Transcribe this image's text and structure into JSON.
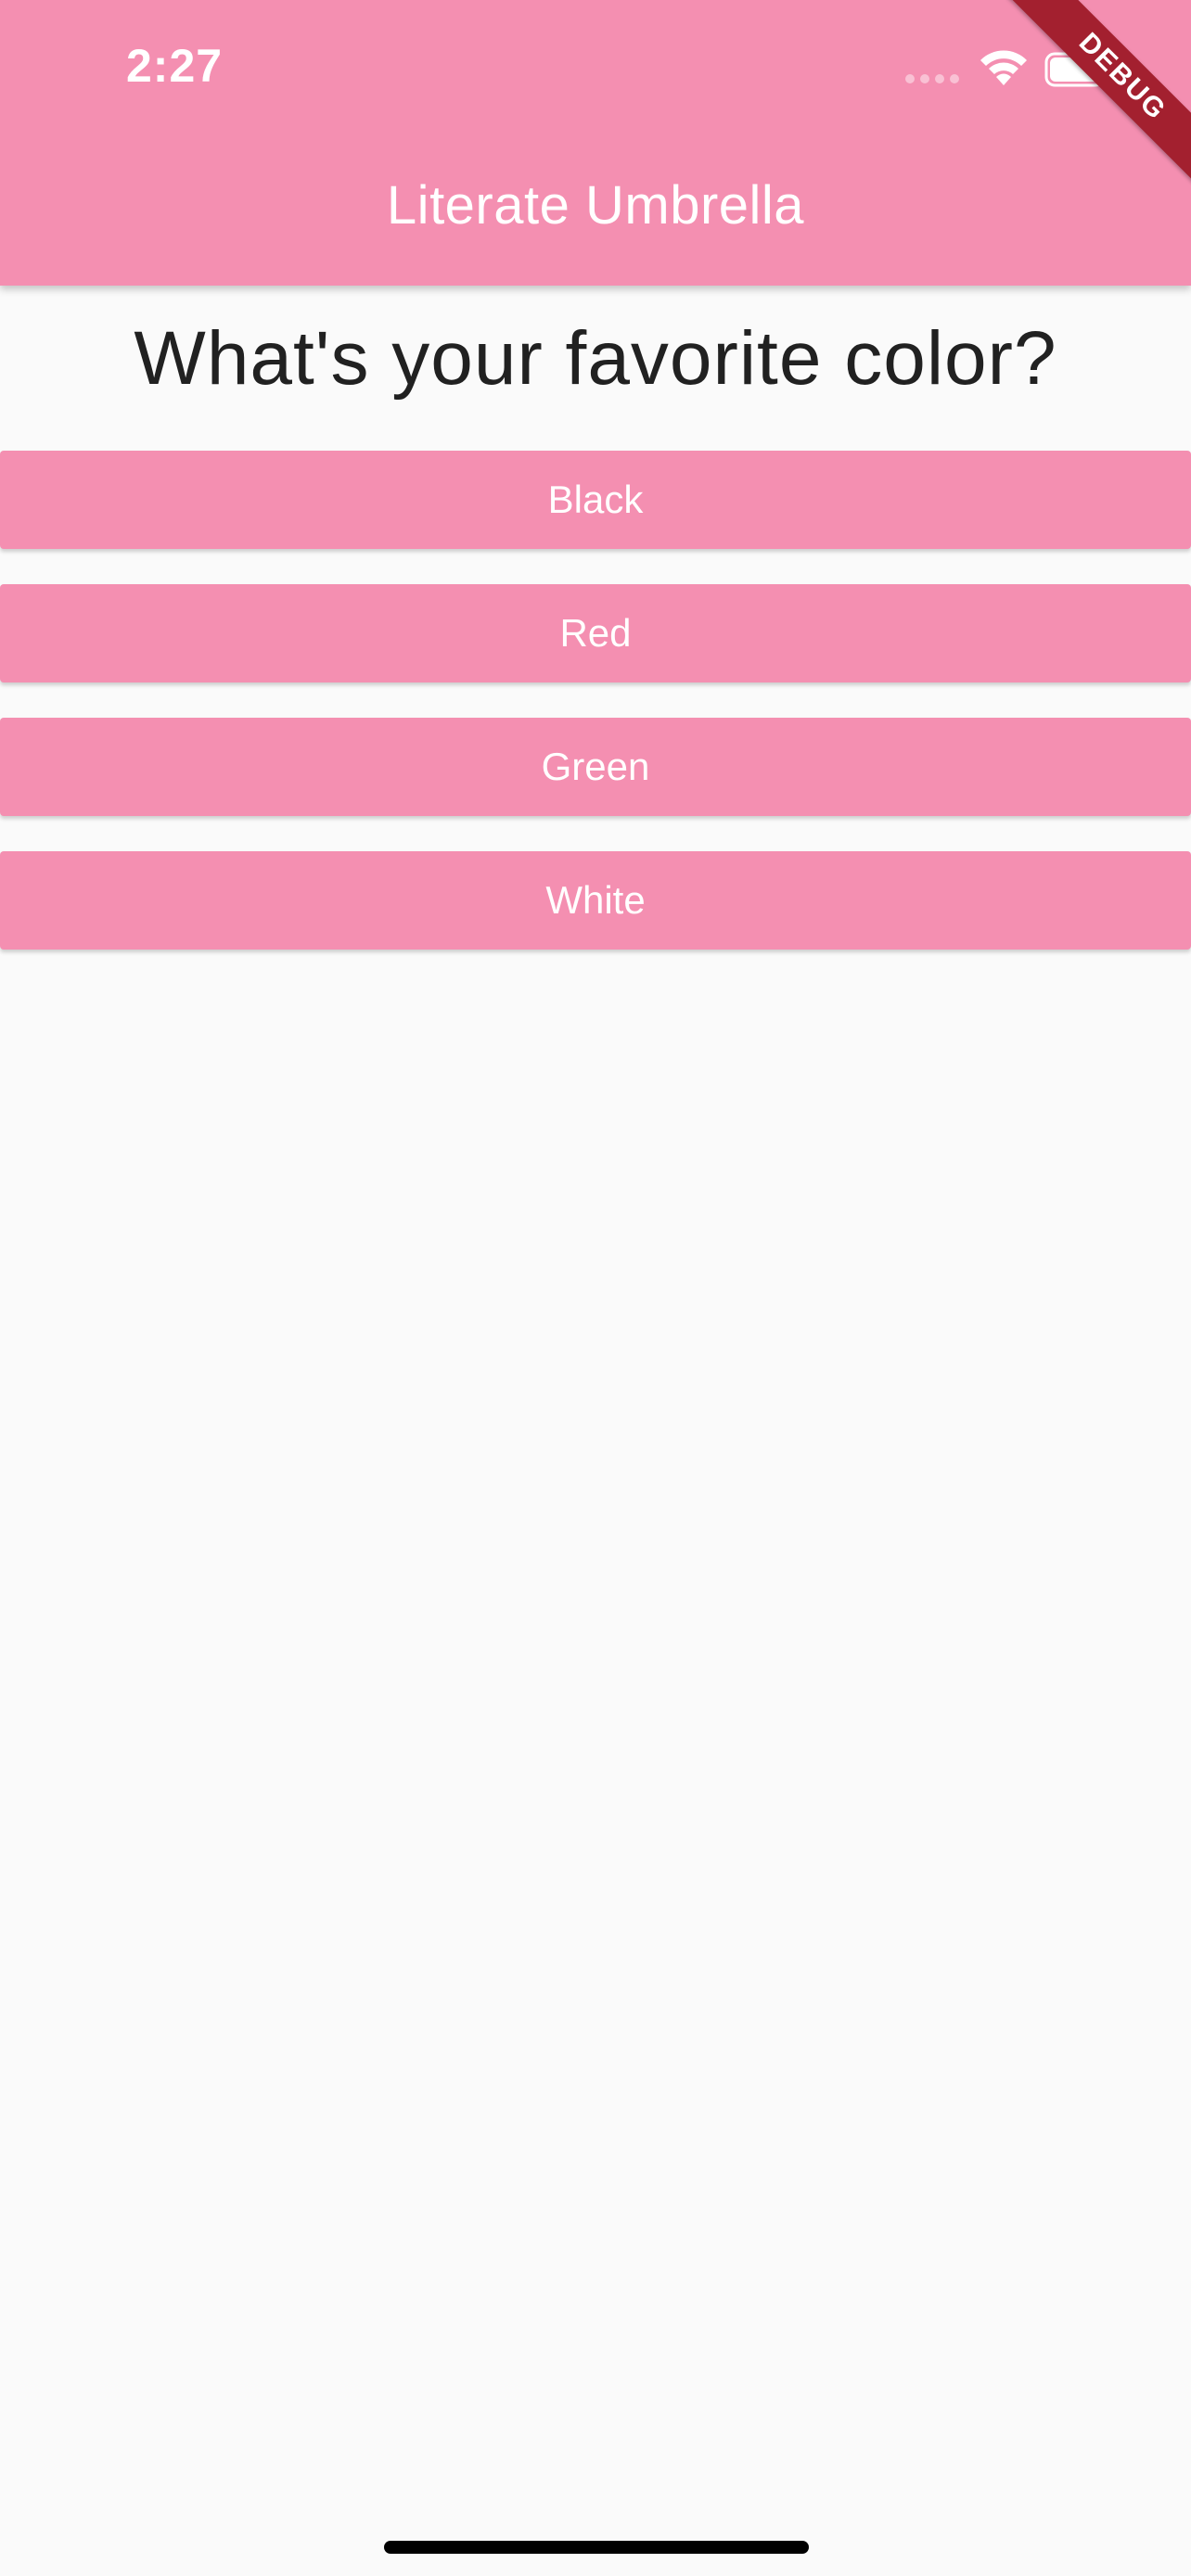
{
  "status_bar": {
    "time": "2:27"
  },
  "app_bar": {
    "title": "Literate Umbrella"
  },
  "debug_banner": {
    "label": "DEBUG"
  },
  "question": {
    "text": "What's your favorite color?"
  },
  "answers": [
    {
      "label": "Black"
    },
    {
      "label": "Red"
    },
    {
      "label": "Green"
    },
    {
      "label": "White"
    }
  ],
  "colors": {
    "primary": "#f48fb1",
    "background": "#fafafa",
    "debug_ribbon": "#a3202f",
    "question_text": "#212121"
  },
  "icons": {
    "signal": "cellular-signal-icon",
    "wifi": "wifi-icon",
    "battery": "battery-icon"
  }
}
